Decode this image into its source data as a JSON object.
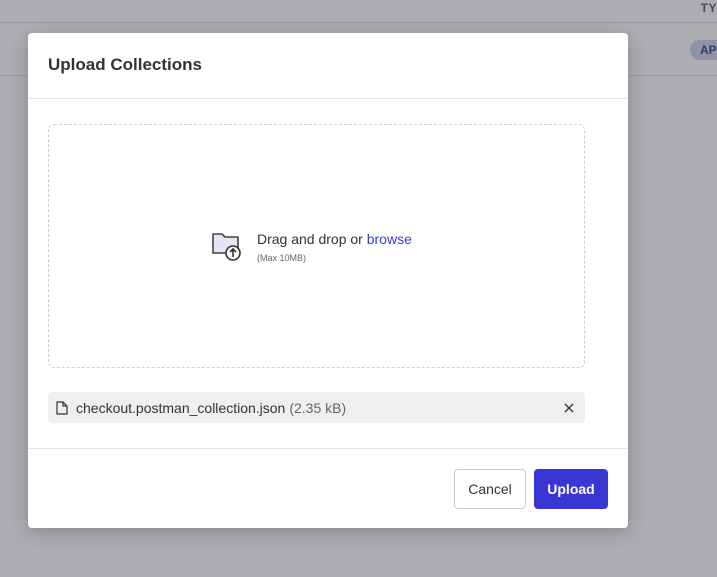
{
  "background": {
    "column_header": "TY",
    "badge": "AP"
  },
  "modal": {
    "title": "Upload Collections",
    "dropzone": {
      "text": "Drag and drop or ",
      "link": "browse",
      "hint": "(Max 10MB)",
      "icon": "folder-upload-icon"
    },
    "file": {
      "name": "checkout.postman_collection.json",
      "size": "(2.35 kB)",
      "icon": "file-icon"
    },
    "buttons": {
      "cancel": "Cancel",
      "upload": "Upload"
    }
  },
  "colors": {
    "accent": "#3a36d4",
    "link": "#3b3bd6"
  }
}
